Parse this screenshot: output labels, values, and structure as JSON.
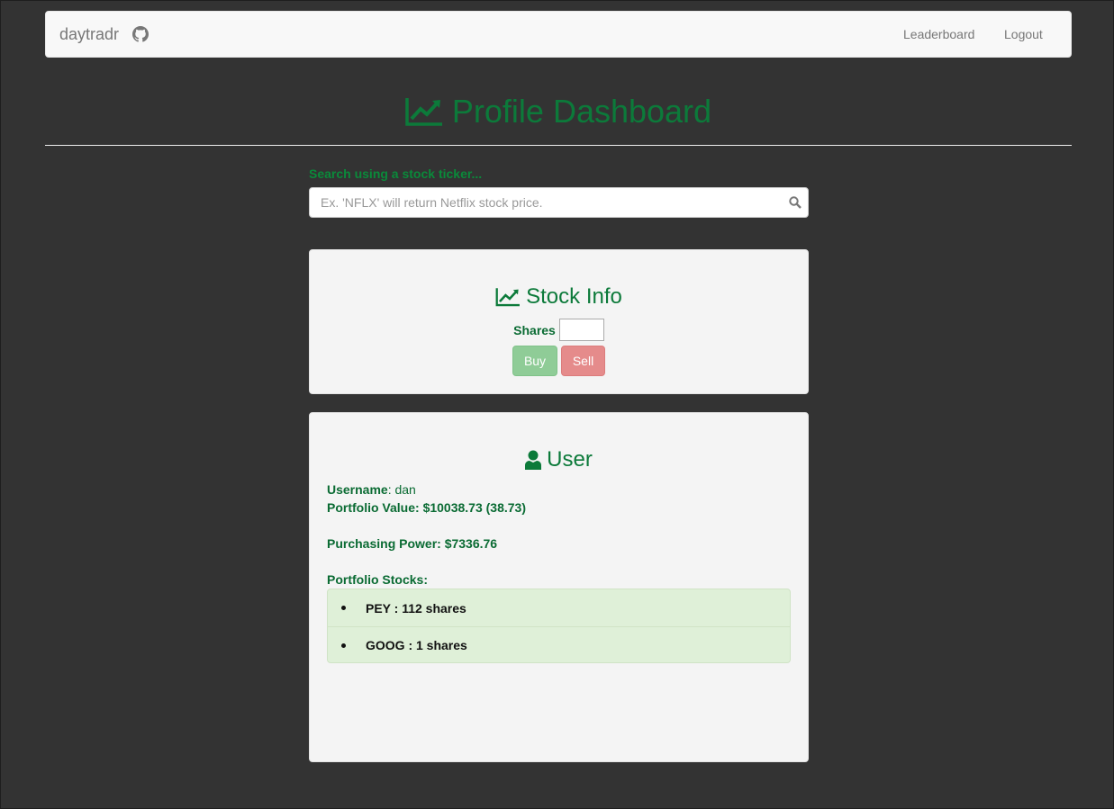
{
  "navbar": {
    "brand": "daytradr",
    "links": [
      "Leaderboard",
      "Logout"
    ]
  },
  "header": {
    "title": "Profile Dashboard"
  },
  "search": {
    "label": "Search using a stock ticker...",
    "placeholder": "Ex. 'NFLX' will return Netflix stock price."
  },
  "stock_panel": {
    "title": "Stock Info",
    "shares_label": "Shares",
    "shares_value": "",
    "buy_label": "Buy",
    "sell_label": "Sell"
  },
  "user_panel": {
    "title": "User",
    "username_label": "Username",
    "username_value": ": dan",
    "portfolio_value": "Portfolio Value: $10038.73 (38.73)",
    "purchasing_power": "Purchasing Power: $7336.76",
    "stocks_label": "Portfolio Stocks:",
    "stocks": [
      "PEY : 112 shares",
      "GOOG : 1 shares"
    ]
  },
  "colors": {
    "accent": "#0c7a3a",
    "background": "#333333",
    "buy": "#8fcc97",
    "sell": "#e58b8b",
    "list_bg": "#dff0d8"
  }
}
